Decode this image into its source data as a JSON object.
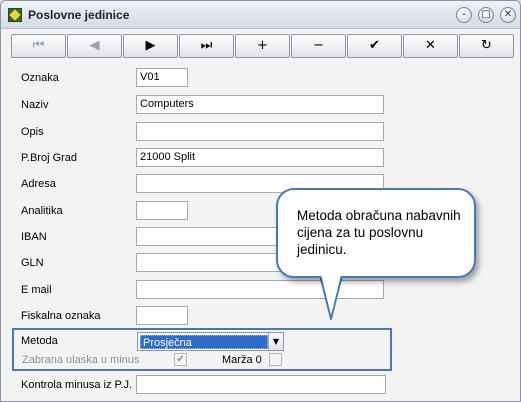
{
  "window": {
    "title": "Poslovne jedinice"
  },
  "window_controls": {
    "minimize": "–",
    "restore": "□",
    "close": "✕"
  },
  "toolbar": {
    "buttons": [
      {
        "glyph": "⏮",
        "name": "first"
      },
      {
        "glyph": "◀",
        "name": "previous"
      },
      {
        "glyph": "▶",
        "name": "next"
      },
      {
        "glyph": "⏭",
        "name": "last"
      },
      {
        "glyph": "+",
        "name": "add"
      },
      {
        "glyph": "−",
        "name": "delete"
      },
      {
        "glyph": "✔",
        "name": "save"
      },
      {
        "glyph": "✕",
        "name": "cancel"
      },
      {
        "glyph": "↻",
        "name": "refresh"
      }
    ]
  },
  "form": {
    "oznaka": {
      "label": "Oznaka",
      "value": "V01"
    },
    "naziv": {
      "label": "Naziv",
      "value": "Computers"
    },
    "opis": {
      "label": "Opis",
      "value": ""
    },
    "pbroj_grad": {
      "label": "P.Broj Grad",
      "value": "21000 Split"
    },
    "adresa": {
      "label": "Adresa",
      "value": ""
    },
    "analitika": {
      "label": "Analitika",
      "value": ""
    },
    "iban": {
      "label": "IBAN",
      "value": ""
    },
    "gln": {
      "label": "GLN",
      "value": ""
    },
    "email": {
      "label": "E mail",
      "value": ""
    },
    "fiskalna": {
      "label": "Fiskalna oznaka",
      "value": ""
    },
    "metoda": {
      "label": "Metoda",
      "value": "Prosječna"
    },
    "zabrana": {
      "label": "Zabrana ulaska u minus",
      "checked": true
    },
    "marza": {
      "label": "Marža 0",
      "checked": false
    },
    "kontrola": {
      "label": "Kontrola minusa iz P.J.",
      "value": ""
    }
  },
  "callout": {
    "text": "Metoda obračuna nabavnih cijena za tu poslovnu jedinicu."
  },
  "colors": {
    "highlight_border": "#4a78b8",
    "selection": "#2e6cc7"
  }
}
